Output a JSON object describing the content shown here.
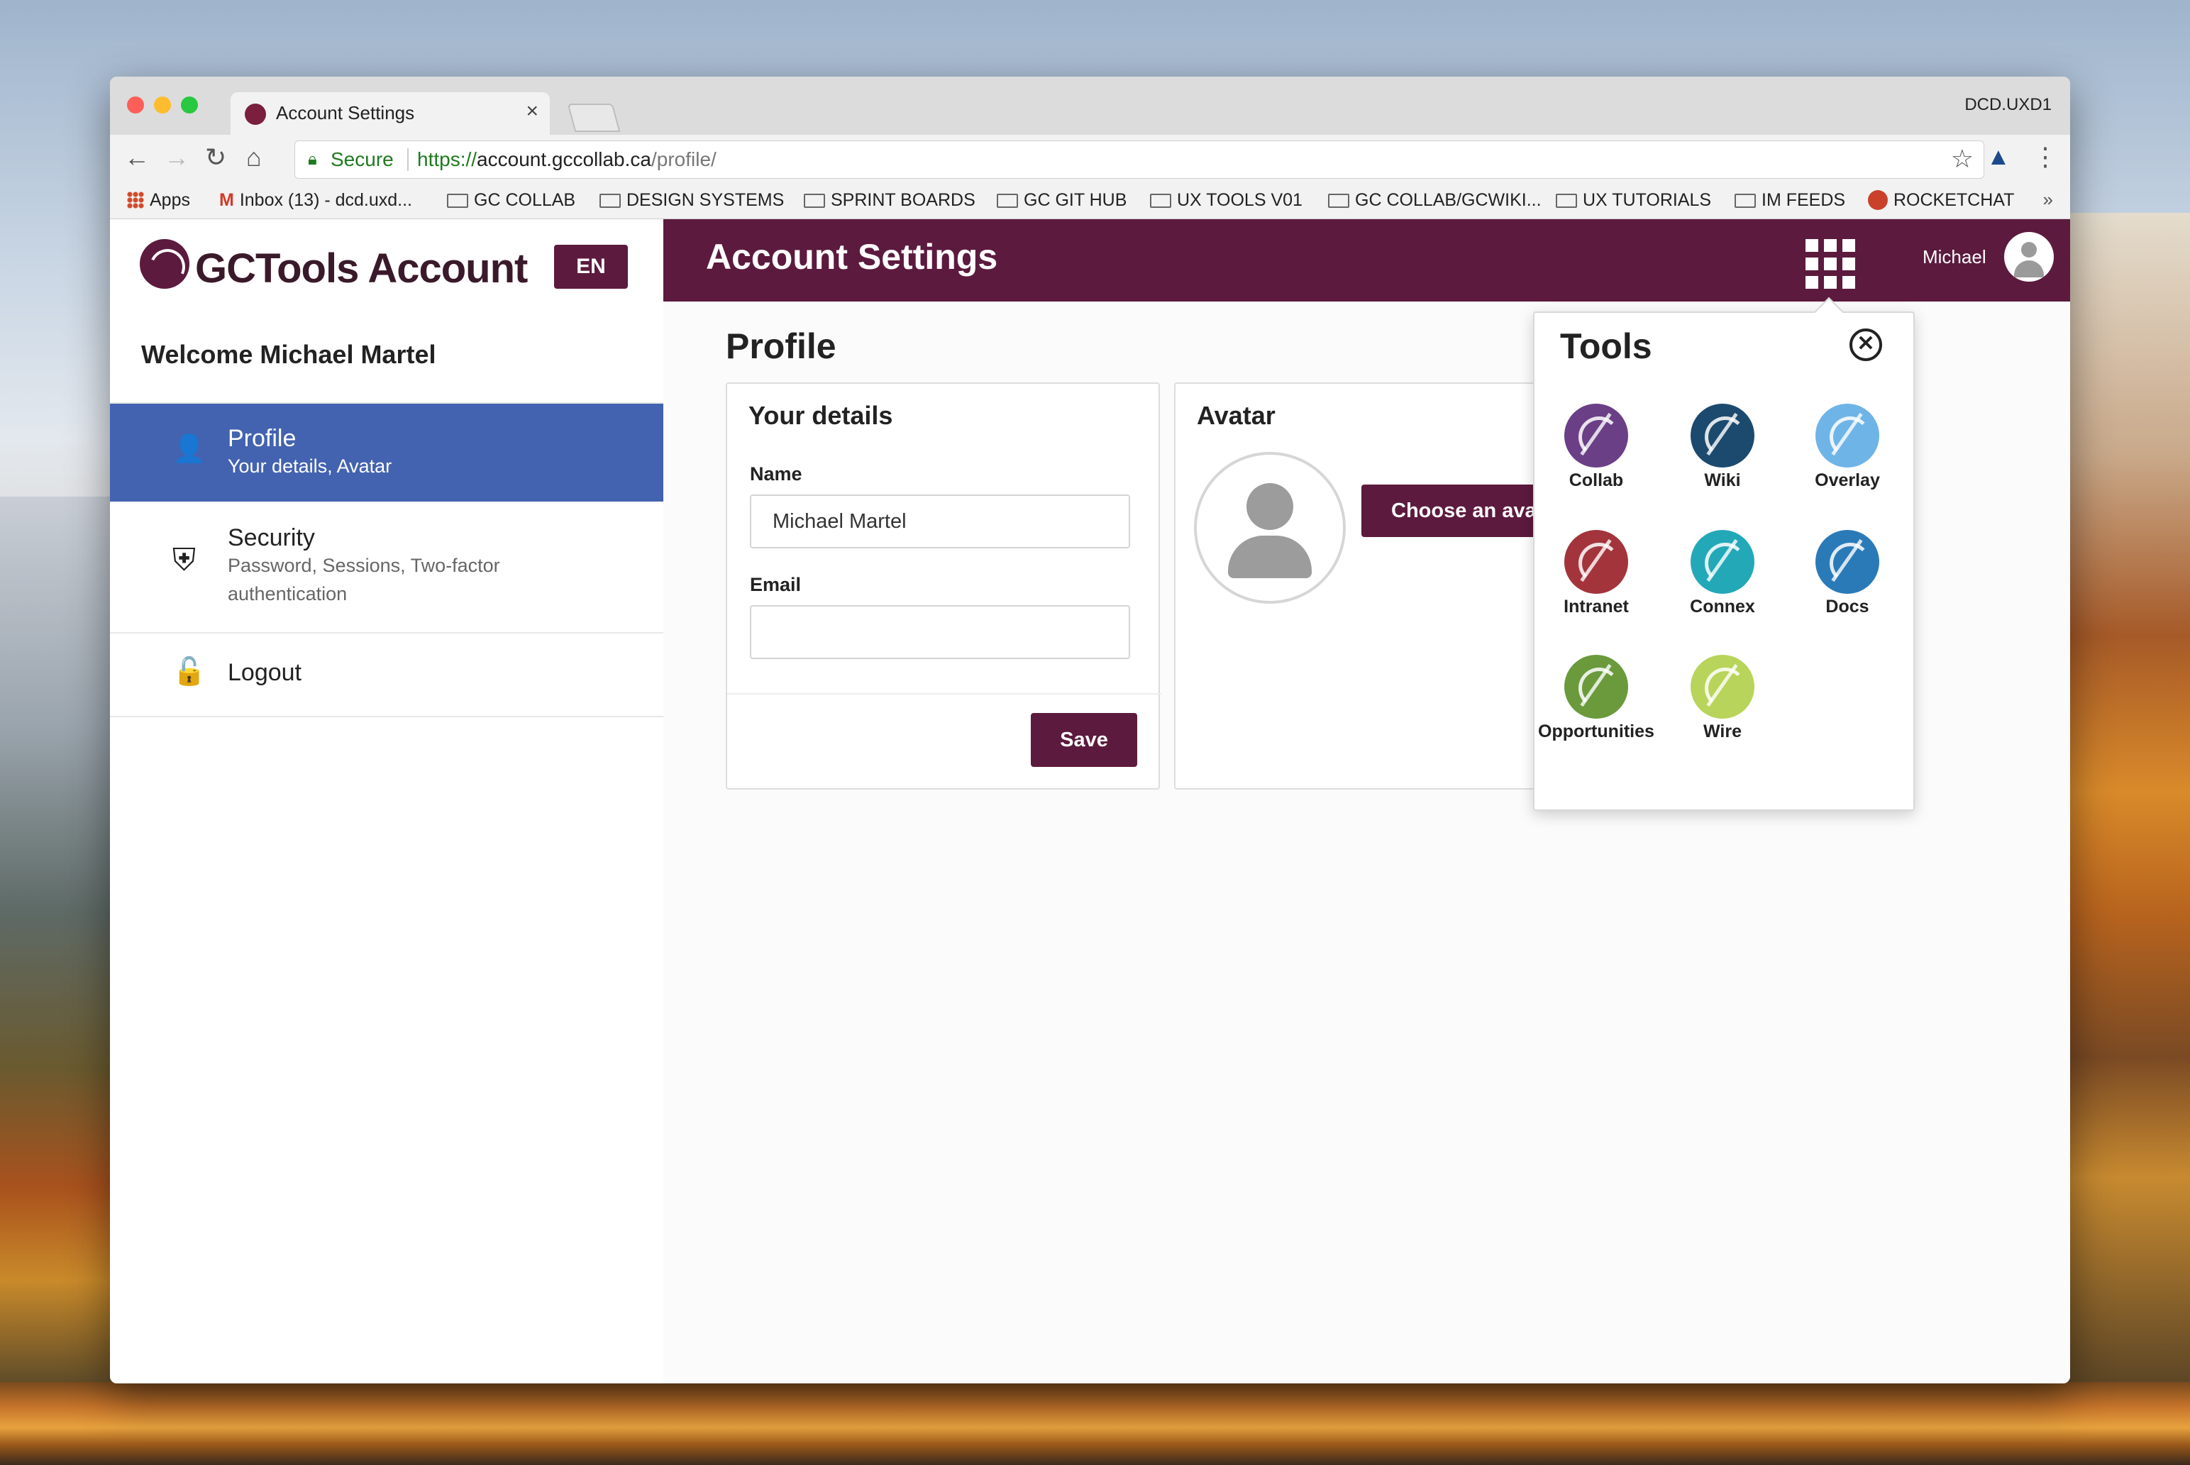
{
  "browser": {
    "tab_title": "Account Settings",
    "tab_close": "×",
    "window_label": "DCD.UXD1",
    "back": "←",
    "forward": "→",
    "reload": "↻",
    "home": "⌂",
    "secure_label": "Secure",
    "url_scheme": "https://",
    "url_host": "account.gccollab.ca",
    "url_path": "/profile/",
    "bookmark_star": "☆",
    "extension_icon": "▲",
    "menu_dots": "⋮",
    "bookmarks": [
      {
        "label": "Apps",
        "icon": "apps-grid-icon"
      },
      {
        "label": "Inbox (13) - dcd.uxd...",
        "icon": "gmail-icon"
      },
      {
        "label": "GC COLLAB",
        "icon": "folder-icon"
      },
      {
        "label": "DESIGN SYSTEMS",
        "icon": "folder-icon"
      },
      {
        "label": "SPRINT BOARDS",
        "icon": "folder-icon"
      },
      {
        "label": "GC GIT HUB",
        "icon": "folder-icon"
      },
      {
        "label": "UX TOOLS V01",
        "icon": "folder-icon"
      },
      {
        "label": "GC COLLAB/GCWIKI...",
        "icon": "folder-icon"
      },
      {
        "label": "UX TUTORIALS",
        "icon": "folder-icon"
      },
      {
        "label": "IM FEEDS",
        "icon": "folder-icon"
      },
      {
        "label": "ROCKETCHAT",
        "icon": "rocketchat-icon"
      }
    ],
    "bookmarks_more": "»"
  },
  "sidebar": {
    "brand": "GCTools Account",
    "lang_button": "EN",
    "welcome": "Welcome Michael Martel",
    "items": [
      {
        "title": "Profile",
        "subtitle": "Your details, Avatar",
        "icon": "👤"
      },
      {
        "title": "Security",
        "subtitle": "Password, Sessions, Two-factor authentication",
        "icon": "⛨"
      },
      {
        "title": "Logout",
        "subtitle": "",
        "icon": "🔓"
      }
    ]
  },
  "header": {
    "title": "Account Settings",
    "user_name": "Michael"
  },
  "main": {
    "page_title": "Profile",
    "details_card": {
      "title": "Your details",
      "name_label": "Name",
      "name_value": "Michael Martel",
      "email_label": "Email",
      "email_value": "",
      "save_label": "Save"
    },
    "avatar_card": {
      "title": "Avatar",
      "choose_label": "Choose an avatar"
    }
  },
  "tools_panel": {
    "title": "Tools",
    "close": "✕",
    "tools": [
      {
        "label": "Collab",
        "color": "#6a3f86"
      },
      {
        "label": "Wiki",
        "color": "#1c4a6e"
      },
      {
        "label": "Overlay",
        "color": "#6fb4e6"
      },
      {
        "label": "Intranet",
        "color": "#a3343c"
      },
      {
        "label": "Connex",
        "color": "#23a8b8"
      },
      {
        "label": "Docs",
        "color": "#2a7ab8"
      },
      {
        "label": "Opportunities",
        "color": "#6a9a3c"
      },
      {
        "label": "Wire",
        "color": "#b8d45a"
      }
    ]
  },
  "colors": {
    "brand": "#5c1a3e",
    "active_nav": "#4363b0"
  }
}
